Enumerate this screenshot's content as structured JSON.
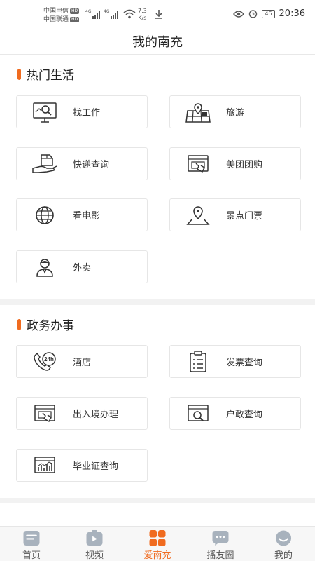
{
  "status": {
    "carrier1": "中国电信",
    "carrier2": "中国联通",
    "hd": "HD",
    "net1": "4G",
    "net2": "4G",
    "speed_value": "7.3",
    "speed_unit": "K/s",
    "battery": "46",
    "time": "20:36"
  },
  "header": {
    "title": "我的南充"
  },
  "sections": [
    {
      "title": "热门生活",
      "items": [
        {
          "label": "找工作",
          "icon": "job-search-icon"
        },
        {
          "label": "旅游",
          "icon": "travel-map-icon"
        },
        {
          "label": "快递查询",
          "icon": "express-package-icon"
        },
        {
          "label": "美团团购",
          "icon": "group-buy-icon"
        },
        {
          "label": "看电影",
          "icon": "globe-movie-icon"
        },
        {
          "label": "景点门票",
          "icon": "location-pin-icon"
        },
        {
          "label": "外卖",
          "icon": "delivery-person-icon"
        }
      ]
    },
    {
      "title": "政务办事",
      "items": [
        {
          "label": "酒店",
          "icon": "phone-24h-icon"
        },
        {
          "label": "发票查询",
          "icon": "clipboard-list-icon"
        },
        {
          "label": "出入境办理",
          "icon": "browser-hand-icon"
        },
        {
          "label": "户政查询",
          "icon": "browser-search-icon"
        },
        {
          "label": "毕业证查询",
          "icon": "browser-chart-icon"
        }
      ]
    }
  ],
  "tabs": [
    {
      "label": "首页",
      "icon": "home-doc-icon",
      "active": false
    },
    {
      "label": "视频",
      "icon": "video-play-icon",
      "active": false
    },
    {
      "label": "爱南充",
      "icon": "grid-apps-icon",
      "active": true
    },
    {
      "label": "播友圈",
      "icon": "chat-bubble-icon",
      "active": false
    },
    {
      "label": "我的",
      "icon": "profile-face-icon",
      "active": false
    }
  ],
  "colors": {
    "accent": "#f06b1f",
    "tab_inactive": "#a8b2bd",
    "icon_stroke": "#333333"
  }
}
